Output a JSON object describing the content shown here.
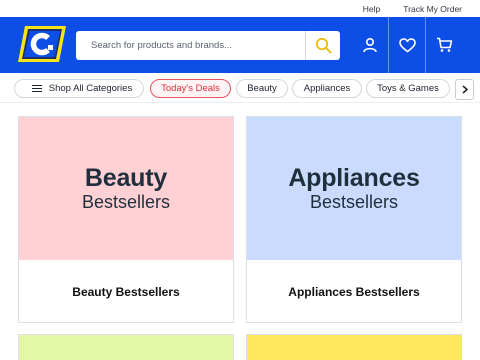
{
  "utility": {
    "help": "Help",
    "track": "Track My Order"
  },
  "colors": {
    "header_blue": "#0d4ee6",
    "logo_yellow": "#f7e417",
    "deals_red": "#e22e3a",
    "beauty_bg": "#ffd0d4",
    "appliances_bg": "#c9dcff",
    "green_bg": "#e3f7a5",
    "yellow_bg": "#fde75c"
  },
  "header": {
    "logo": "logo-icon",
    "search_placeholder": "Search for products and brands...",
    "icons": [
      "search-icon",
      "user-icon",
      "heart-icon",
      "cart-icon"
    ]
  },
  "categories": {
    "shop_all": "Shop All Categories",
    "items": [
      "Today's Deals",
      "Beauty",
      "Appliances",
      "Toys & Games"
    ],
    "next": "chevron-right-icon"
  },
  "cards": [
    {
      "line1": "Beauty",
      "line2": "Bestsellers",
      "caption": "Beauty Bestsellers"
    },
    {
      "line1": "Appliances",
      "line2": "Bestsellers",
      "caption": "Appliances Bestsellers"
    }
  ]
}
